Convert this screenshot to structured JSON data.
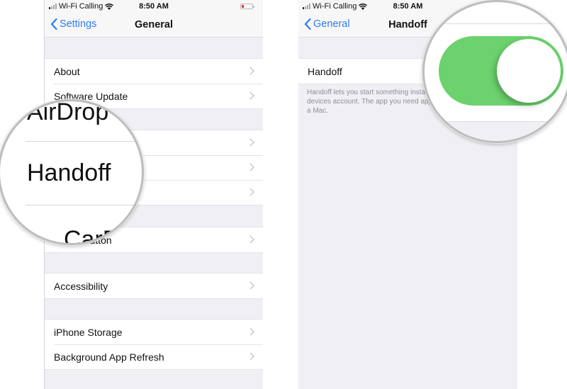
{
  "status_bar": {
    "carrier": "Wi-Fi Calling",
    "time": "8:50 AM"
  },
  "left_screen": {
    "nav": {
      "back_label": "Settings",
      "title": "General"
    },
    "groups": [
      {
        "items": [
          {
            "label": "About"
          },
          {
            "label": "Software Update"
          }
        ]
      },
      {
        "items": [
          {
            "label": "AirDrop"
          },
          {
            "label": "Handoff"
          },
          {
            "label": "CarPlay"
          }
        ]
      },
      {
        "items": [
          {
            "label": "Home Button"
          }
        ]
      },
      {
        "items": [
          {
            "label": "Accessibility"
          }
        ]
      },
      {
        "items": [
          {
            "label": "iPhone Storage"
          },
          {
            "label": "Background App Refresh"
          }
        ]
      }
    ],
    "magnifier": {
      "top_text": "AirDrop",
      "main_text": "Handoff",
      "bottom_text": "CarPlay"
    }
  },
  "right_screen": {
    "nav": {
      "back_label": "General",
      "title": "Handoff"
    },
    "handoff_row": {
      "label": "Handoff",
      "toggle_on": true
    },
    "footer": "Handoff lets you start something instantly pick it up on other devices account. The app you need appears and in the Dock on a Mac.",
    "toggle_color": "#6bd26d"
  },
  "colors": {
    "accent": "#2f7bf5",
    "toggle_on": "#6bd26d",
    "battery_low": "#e53935"
  }
}
